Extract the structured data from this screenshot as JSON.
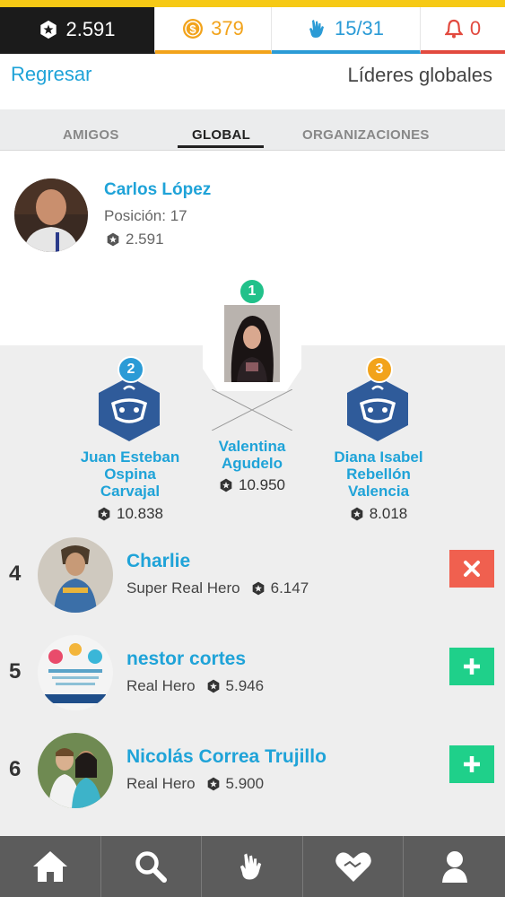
{
  "stats": {
    "points": "2.591",
    "coins": "379",
    "level": "15/31",
    "alerts": "0"
  },
  "header": {
    "back_label": "Regresar",
    "title": "Líderes globales"
  },
  "tabs": [
    {
      "label": "AMIGOS",
      "active": false
    },
    {
      "label": "GLOBAL",
      "active": true
    },
    {
      "label": "ORGANIZACIONES",
      "active": false
    }
  ],
  "me": {
    "name": "Carlos López",
    "position": "Posición: 17",
    "score": "2.591"
  },
  "podium": [
    {
      "rank": "1",
      "name": "Valentina Agudelo",
      "name_lines": [
        "Valentina",
        "Agudelo"
      ],
      "score": "10.950"
    },
    {
      "rank": "2",
      "name": "Juan Esteban Ospina Carvajal",
      "name_lines": [
        "Juan Esteban",
        "Ospina",
        "Carvajal"
      ],
      "score": "10.838"
    },
    {
      "rank": "3",
      "name": "Diana Isabel Rebellón Valencia",
      "name_lines": [
        "Diana Isabel",
        "Rebellón",
        "Valencia"
      ],
      "score": "8.018"
    }
  ],
  "list": [
    {
      "rank": "4",
      "name": "Charlie",
      "level": "Super Real Hero",
      "score": "6.147",
      "action": "remove"
    },
    {
      "rank": "5",
      "name": "nestor cortes",
      "level": "Real Hero",
      "score": "5.946",
      "action": "add"
    },
    {
      "rank": "6",
      "name": "Nicolás Correa Trujillo",
      "level": "Real Hero",
      "score": "5.900",
      "action": "add"
    }
  ],
  "nav": [
    "home-icon",
    "search-icon",
    "hand-icon",
    "heart-handshake-icon",
    "profile-icon"
  ],
  "colors": {
    "accent": "#1fa3d8",
    "coins": "#f2a31b",
    "alerts": "#e24a3f",
    "remove": "#f0604f",
    "add": "#1fd08a",
    "rank1": "#21c18a",
    "rank2": "#2b9bd6",
    "rank3": "#f2a31b",
    "nav_bg": "#5c5c5c"
  }
}
